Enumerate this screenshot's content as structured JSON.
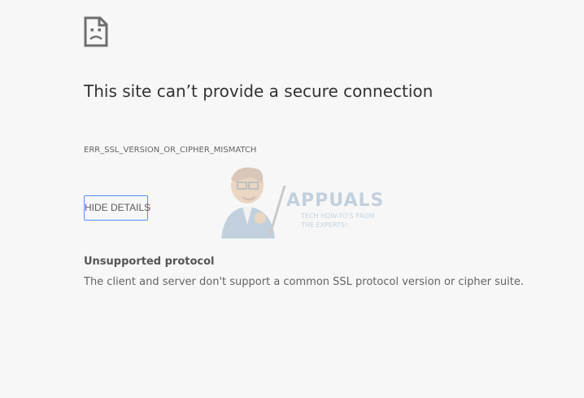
{
  "error_page": {
    "icon": "sad-page-icon",
    "title": "This site can’t provide a secure connection",
    "error_code": "ERR_SSL_VERSION_OR_CIPHER_MISMATCH",
    "details_button_label": "HIDE DETAILS",
    "details": {
      "heading": "Unsupported protocol",
      "body": "The client and server don't support a common SSL protocol version or cipher suite."
    }
  },
  "watermark": {
    "brand": "APPUALS",
    "tagline": "TECH HOW-TO'S FROM THE EXPERTS!"
  },
  "colors": {
    "background": "#f7f7f7",
    "button_border": "#4d90fe",
    "title_text": "#333333",
    "body_text": "#646464"
  }
}
